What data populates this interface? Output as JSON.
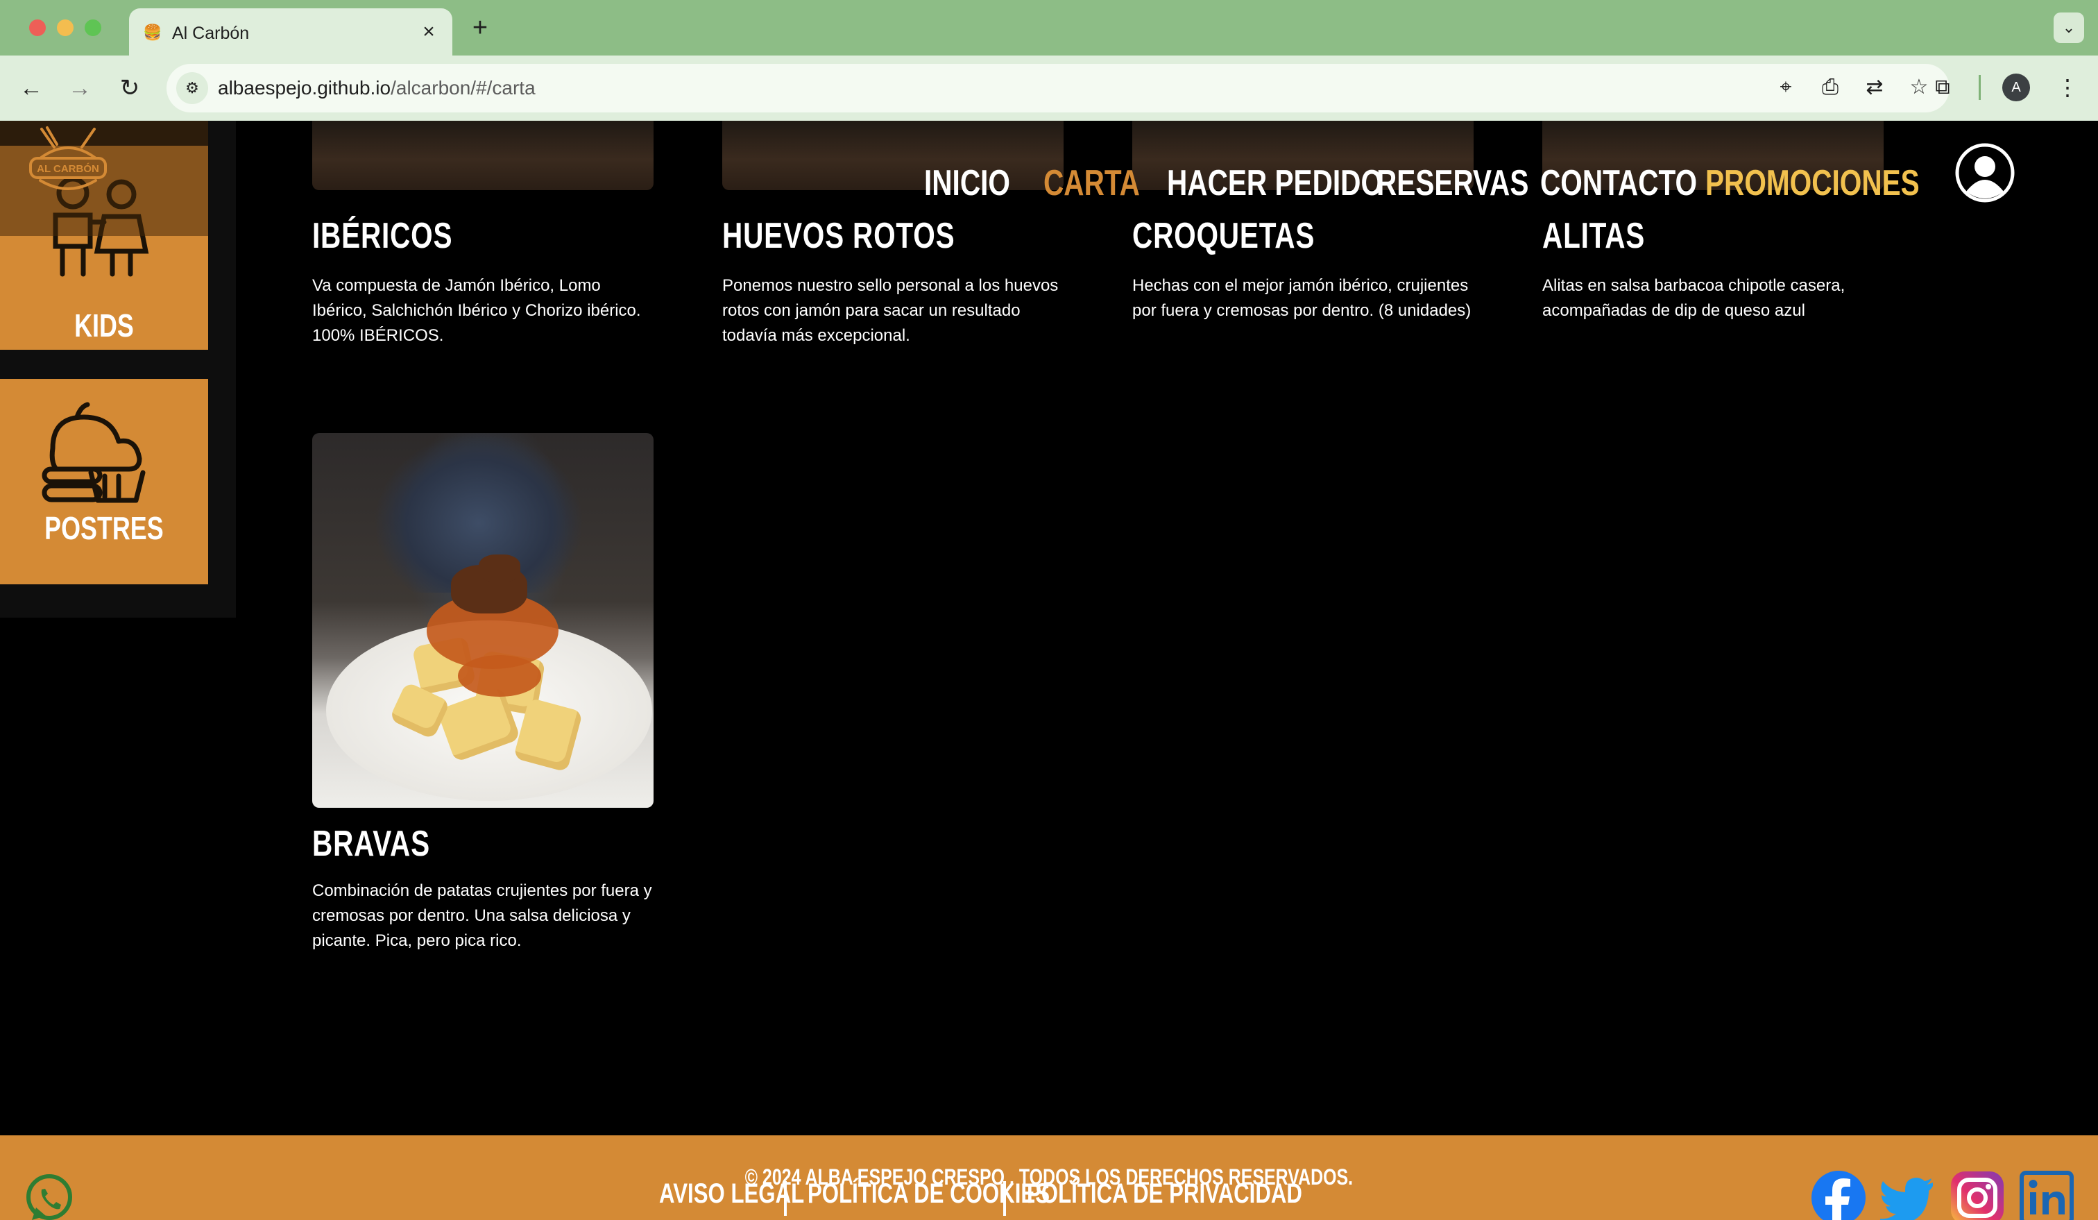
{
  "browser": {
    "tab_title": "Al Carbón",
    "tab_favicon": "burger-icon",
    "url_host": "albaespejo.github.io",
    "url_path": "/alcarbon/#/carta",
    "profile_initial": "A"
  },
  "nav": {
    "items": [
      "INICIO",
      "CARTA",
      "HACER PEDIDO",
      "RESERVAS",
      "CONTACTO",
      "PROMOCIONES"
    ],
    "active": "CARTA"
  },
  "logo": {
    "text": "AL CARBÓN"
  },
  "sidebar": {
    "categories": [
      {
        "label": "KIDS",
        "icon": "kids-icon"
      },
      {
        "label": "POSTRES",
        "icon": "cupcake-icon"
      }
    ]
  },
  "menu": {
    "items": [
      {
        "name": "IBÉRICOS",
        "description": "Va compuesta de Jamón Ibérico, Lomo Ibérico, Salchichón Ibérico y Chorizo ibérico. 100% IBÉRICOS."
      },
      {
        "name": "HUEVOS ROTOS",
        "description": "Ponemos nuestro sello personal a los huevos rotos con jamón para sacar un resultado todavía más excepcional."
      },
      {
        "name": "CROQUETAS",
        "description": "Hechas con el mejor jamón ibérico, crujientes por fuera y cremosas por dentro. (8 unidades)"
      },
      {
        "name": "ALITAS",
        "description": "Alitas en salsa barbacoa chipotle casera, acompañadas de dip de queso azul"
      },
      {
        "name": "BRAVAS",
        "description": "Combinación de patatas crujientes por fuera y cremosas por dentro. Una salsa deliciosa y picante. Pica, pero pica rico."
      }
    ]
  },
  "footer": {
    "links": [
      "AVISO LEGAL",
      "POLÍTICA DE COOKIES",
      "POLÍTICA DE PRIVACIDAD"
    ],
    "social": [
      "facebook-icon",
      "twitter-icon",
      "instagram-icon",
      "linkedin-icon"
    ],
    "copyright": "© 2024 ALBA ESPEJO CRESPO . TODOS LOS DERECHOS RESERVADOS."
  },
  "colors": {
    "accent": "#d48a35",
    "promo": "#f2c14e",
    "page_bg": "#000000",
    "chrome_green": "#8dbd86"
  }
}
